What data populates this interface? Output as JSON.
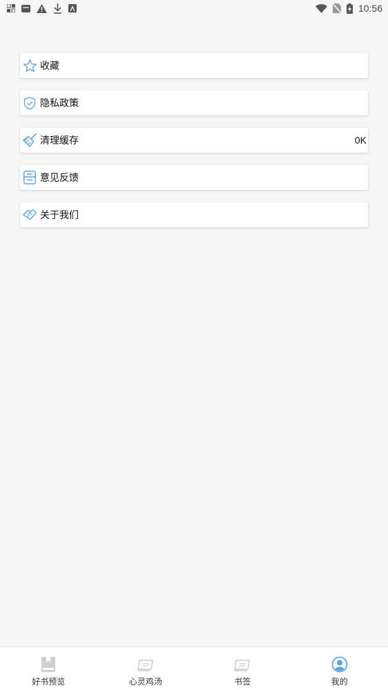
{
  "status_bar": {
    "time": "10:56",
    "left_icons": [
      "notification-grid-icon",
      "message-icon",
      "warning-icon",
      "download-icon",
      "a-icon"
    ],
    "right_icons": [
      "wifi-icon",
      "no-sim-icon",
      "battery-charging-icon"
    ]
  },
  "menu": {
    "items": [
      {
        "label": "收藏",
        "icon": "star-icon",
        "value": ""
      },
      {
        "label": "隐私政策",
        "icon": "shield-check-icon",
        "value": ""
      },
      {
        "label": "清理缓存",
        "icon": "broom-icon",
        "value": "0K"
      },
      {
        "label": "意见反馈",
        "icon": "feedback-box-icon",
        "value": ""
      },
      {
        "label": "关于我们",
        "icon": "handshake-icon",
        "value": ""
      }
    ]
  },
  "tabs": [
    {
      "label": "好书预览",
      "icon": "book-icon",
      "active": false
    },
    {
      "label": "心灵鸡汤",
      "icon": "note-icon",
      "active": false
    },
    {
      "label": "书签",
      "icon": "bookmark-note-icon",
      "active": false
    },
    {
      "label": "我的",
      "icon": "profile-icon",
      "active": true
    }
  ],
  "colors": {
    "accent": "#5aa5e6",
    "tab_inactive": "#c9c9c9",
    "background": "#f6f6f6"
  }
}
